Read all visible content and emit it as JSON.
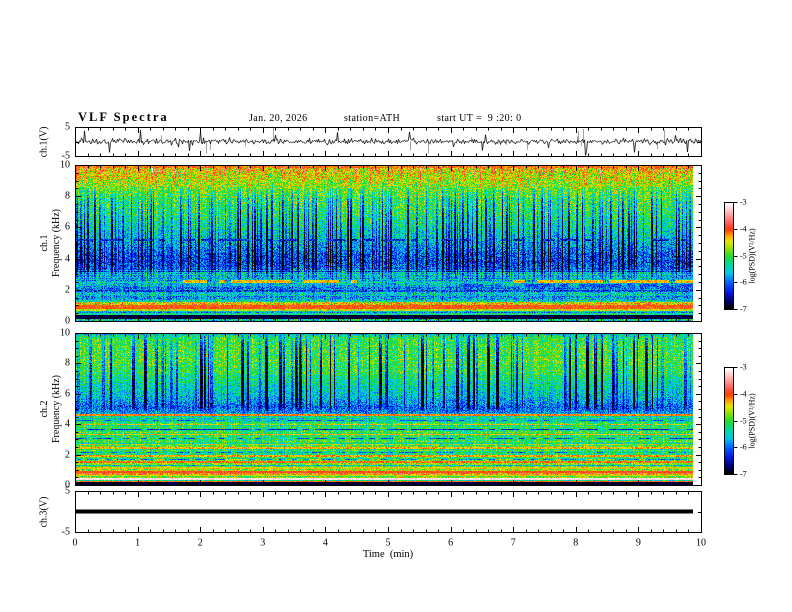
{
  "header": {
    "title": "VLF Spectra",
    "date": "Jan. 20, 2026",
    "station": "station=ATH",
    "start_ut": "start UT =  9 :20: 0"
  },
  "panels": {
    "ch1_wave": {
      "ylabel": "ch.1(V)",
      "yticks": [
        "5",
        "-5"
      ],
      "ylim": [
        -5,
        5
      ]
    },
    "spec1": {
      "ylabel_line1": "ch.1",
      "ylabel_line2": "Frequency (kHz)",
      "yticks": [
        "10",
        "8",
        "6",
        "4",
        "2",
        "0"
      ],
      "ylim": [
        0,
        10
      ]
    },
    "spec2": {
      "ylabel_line1": "ch.2",
      "ylabel_line2": "Frequency (kHz)",
      "yticks": [
        "10",
        "8",
        "6",
        "4",
        "2",
        "0"
      ],
      "ylim": [
        0,
        10
      ]
    },
    "ch3_wave": {
      "ylabel": "ch.3(V)",
      "yticks": [
        "5",
        "-5"
      ],
      "ylim": [
        -5,
        5
      ]
    }
  },
  "xaxis": {
    "label": "Time  (min)",
    "ticks": [
      "0",
      "1",
      "2",
      "3",
      "4",
      "5",
      "6",
      "7",
      "8",
      "9",
      "10"
    ],
    "lim": [
      0,
      10
    ]
  },
  "colorbar": {
    "label": "log(PSD)(V²/Hz)",
    "ticks": [
      "-3",
      "-4",
      "-5",
      "-6",
      "-7"
    ],
    "lim": [
      -7,
      -3
    ]
  },
  "colormap": {
    "levels": [
      -7.0,
      -6.75,
      -6.4,
      -6.0,
      -5.65,
      -5.3,
      -5.0,
      -4.7,
      -4.45,
      -4.2,
      -4.0,
      -3.75,
      -3.45,
      -3.2,
      -3.0
    ],
    "colors": [
      "#000000",
      "#000064",
      "#0014DC",
      "#0064FF",
      "#00C8E6",
      "#00DC96",
      "#28DC28",
      "#96E100",
      "#E6E600",
      "#FF9600",
      "#FF3C00",
      "#FF5A5A",
      "#FFA0A0",
      "#FFD7D7",
      "#FFFFFF"
    ]
  },
  "chart_data": [
    {
      "type": "line",
      "name": "ch1_voltage",
      "xlabel": "Time  (min)",
      "ylabel": "ch.1(V)",
      "xlim": [
        0,
        10
      ],
      "ylim": [
        -5,
        5
      ],
      "data_end_min": 10,
      "seed": 11,
      "signal": {
        "baseline": 0,
        "noise_sigma": 0.5,
        "spike_prob": 0.022,
        "spike_amp_min": 1.2,
        "spike_amp_max": 4.6,
        "gray_spike_prob": 0.015,
        "line_color": "#000000",
        "gray_color": "#8a8a8a"
      }
    },
    {
      "type": "heatmap",
      "name": "ch1_spectrogram",
      "xlabel": "Time  (min)",
      "ylabel": "ch.1 Frequency (kHz)",
      "zlabel": "log(PSD)(V²/Hz)",
      "xlim": [
        0,
        10
      ],
      "ylim": [
        0,
        10
      ],
      "zlim": [
        -7,
        -3
      ],
      "data_end_min": 9.85,
      "seed": 101,
      "noise": 0.5,
      "col_noise": 0.22,
      "row_stripe": 0.42,
      "row_stripe_max_f": 3.3,
      "base_profile": [
        [
          0,
          -6.6
        ],
        [
          0.15,
          -5.8
        ],
        [
          0.3,
          -6.8
        ],
        [
          0.55,
          -6.2
        ],
        [
          0.7,
          -4.9
        ],
        [
          0.9,
          -4.0
        ],
        [
          1.1,
          -4.6
        ],
        [
          1.4,
          -5.5
        ],
        [
          1.8,
          -5.9
        ],
        [
          2.2,
          -5.8
        ],
        [
          2.6,
          -5.5
        ],
        [
          3.0,
          -5.6
        ],
        [
          3.3,
          -6.0
        ],
        [
          3.8,
          -6.15
        ],
        [
          4.3,
          -6.05
        ],
        [
          4.8,
          -5.85
        ],
        [
          5.3,
          -5.6
        ],
        [
          5.8,
          -5.45
        ],
        [
          6.3,
          -5.3
        ],
        [
          6.8,
          -5.15
        ],
        [
          7.3,
          -5.05
        ],
        [
          7.9,
          -4.95
        ],
        [
          8.5,
          -4.8
        ],
        [
          9.0,
          -4.65
        ],
        [
          9.5,
          -4.55
        ],
        [
          9.9,
          -4.4
        ],
        [
          10,
          -4.2
        ]
      ],
      "streaks": {
        "dark": {
          "prob": 0.28,
          "wmax": 2,
          "smin": 0.5,
          "smax": 1.7,
          "f0": 2.6,
          "f1": 8.6
        },
        "bright": {
          "prob": 0.26,
          "wmax": 2,
          "smin": 0.35,
          "smax": 1.0,
          "f0": 8.3,
          "f1": 10
        }
      },
      "hlines": [
        {
          "f": 9.93,
          "th": 0.22,
          "level": -4.1,
          "jitter": 0.3
        },
        {
          "f": 5.22,
          "th": 0.1,
          "level": -6.4,
          "jitter": 0.5,
          "broken": 0.45
        },
        {
          "f": 2.56,
          "th": 0.2,
          "level": -4.35,
          "jitter": 0.3,
          "segs": [
            [
              0.17,
              0.46
            ],
            [
              0.71,
              1.0
            ]
          ],
          "broken": 0.25
        },
        {
          "f": 2.3,
          "th": 0.16,
          "level": -6.1,
          "jitter": 0.35,
          "segs": [
            [
              0.62,
              1.0
            ]
          ],
          "broken": 0.2
        },
        {
          "f": 1.97,
          "th": 0.08,
          "level": -6.2,
          "jitter": 0.45,
          "broken": 0.4
        },
        {
          "f": 0.95,
          "th": 0.26,
          "level": -4.0,
          "jitter": 0.22
        },
        {
          "f": 0.72,
          "th": 0.12,
          "level": -4.55,
          "jitter": 0.35,
          "broken": 0.2
        },
        {
          "f": 0.5,
          "th": 0.12,
          "level": -5.3,
          "jitter": 0.5
        },
        {
          "f": 0.3,
          "th": 0.3,
          "level": -6.85,
          "jitter": 0.15
        },
        {
          "f": 0.08,
          "th": 0.16,
          "level": -5.4,
          "jitter": 0.7
        }
      ]
    },
    {
      "type": "heatmap",
      "name": "ch2_spectrogram",
      "xlabel": "Time  (min)",
      "ylabel": "ch.2 Frequency (kHz)",
      "zlabel": "log(PSD)(V²/Hz)",
      "xlim": [
        0,
        10
      ],
      "ylim": [
        0,
        10
      ],
      "zlim": [
        -7,
        -3
      ],
      "data_end_min": 9.85,
      "seed": 202,
      "noise": 0.45,
      "col_noise": 0.2,
      "row_stripe": 0.35,
      "row_stripe_max_f": 4.7,
      "base_profile": [
        [
          0,
          -6.8
        ],
        [
          0.2,
          -6.3
        ],
        [
          0.4,
          -4.6
        ],
        [
          0.6,
          -4.9
        ],
        [
          0.85,
          -4.2
        ],
        [
          1.05,
          -4.9
        ],
        [
          1.3,
          -5.0
        ],
        [
          1.8,
          -5.05
        ],
        [
          2.3,
          -5.0
        ],
        [
          2.8,
          -5.05
        ],
        [
          3.3,
          -5.05
        ],
        [
          3.8,
          -5.1
        ],
        [
          4.3,
          -5.15
        ],
        [
          4.55,
          -5.3
        ],
        [
          4.8,
          -5.9
        ],
        [
          5.1,
          -6.05
        ],
        [
          5.5,
          -5.85
        ],
        [
          5.9,
          -5.6
        ],
        [
          6.4,
          -5.5
        ],
        [
          6.9,
          -5.3
        ],
        [
          7.4,
          -5.1
        ],
        [
          8.0,
          -5.0
        ],
        [
          8.8,
          -4.98
        ],
        [
          9.6,
          -5.0
        ],
        [
          10,
          -5.4
        ]
      ],
      "streaks": {
        "dark": {
          "prob": 0.15,
          "wmax": 3,
          "smin": 0.7,
          "smax": 2.2,
          "f0": 4.9,
          "f1": 10.01
        }
      },
      "hlines": [
        {
          "f": 9.95,
          "th": 0.12,
          "level": -5.6,
          "jitter": 0.5
        },
        {
          "f": 4.62,
          "th": 0.14,
          "level": -4.15,
          "jitter": 0.25
        },
        {
          "f": 4.28,
          "th": 0.07,
          "level": -6.1,
          "jitter": 0.4,
          "broken": 0.5
        },
        {
          "f": 4.0,
          "th": 0.1,
          "level": -4.35,
          "jitter": 0.3,
          "broken": 0.3
        },
        {
          "f": 3.7,
          "th": 0.08,
          "level": -6.35,
          "jitter": 0.35,
          "broken": 0.3
        },
        {
          "f": 3.37,
          "th": 0.1,
          "level": -4.3,
          "jitter": 0.25
        },
        {
          "f": 3.08,
          "th": 0.07,
          "level": -6.15,
          "jitter": 0.4,
          "broken": 0.5
        },
        {
          "f": 2.72,
          "th": 0.07,
          "level": -4.5,
          "jitter": 0.4,
          "broken": 0.5
        },
        {
          "f": 2.47,
          "th": 0.1,
          "level": -4.3,
          "jitter": 0.3
        },
        {
          "f": 2.2,
          "th": 0.07,
          "level": -6.0,
          "jitter": 0.5,
          "broken": 0.5
        },
        {
          "f": 1.95,
          "th": 0.1,
          "level": -4.25,
          "jitter": 0.3
        },
        {
          "f": 1.7,
          "th": 0.07,
          "level": -5.9,
          "jitter": 0.5,
          "broken": 0.4
        },
        {
          "f": 1.52,
          "th": 0.12,
          "level": -4.1,
          "jitter": 0.25
        },
        {
          "f": 1.3,
          "th": 0.08,
          "level": -5.6,
          "jitter": 0.5
        },
        {
          "f": 1.14,
          "th": 0.1,
          "level": -4.4,
          "jitter": 0.3
        },
        {
          "f": 0.88,
          "th": 0.15,
          "level": -3.95,
          "jitter": 0.2
        },
        {
          "f": 0.66,
          "th": 0.11,
          "level": -4.5,
          "jitter": 0.3
        },
        {
          "f": 0.45,
          "th": 0.15,
          "level": -3.15,
          "jitter": 0.12
        },
        {
          "f": 0.27,
          "th": 0.1,
          "level": -4.05,
          "jitter": 0.3
        },
        {
          "f": 0.1,
          "th": 0.22,
          "level": -6.9,
          "jitter": 0.2
        }
      ]
    },
    {
      "type": "line",
      "name": "ch3_voltage",
      "xlabel": "Time  (min)",
      "ylabel": "ch.3(V)",
      "xlim": [
        0,
        10
      ],
      "ylim": [
        -5,
        5
      ],
      "data_end_min": 9.85,
      "signal": {
        "constant": 0,
        "thickness_v": 1.0,
        "line_color": "#000000"
      }
    }
  ]
}
